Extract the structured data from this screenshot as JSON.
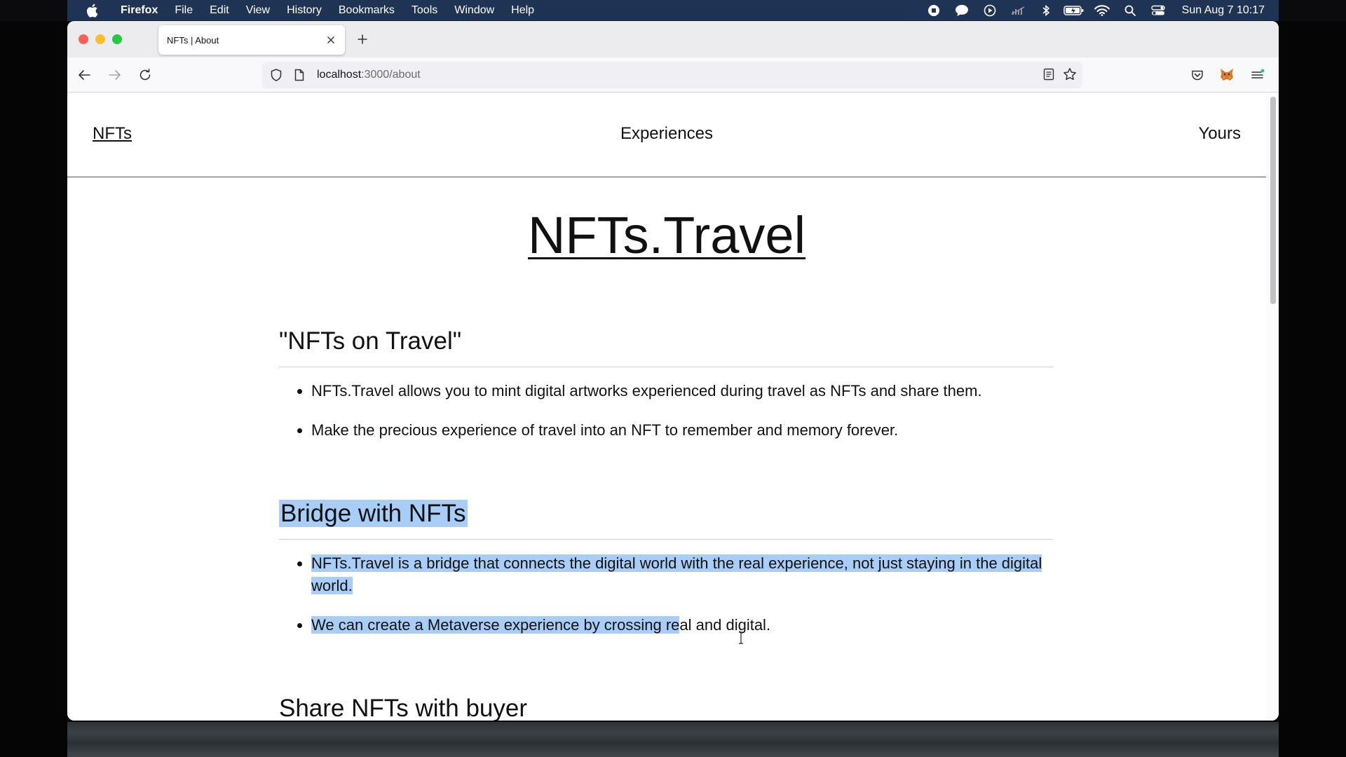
{
  "menubar": {
    "app": "Firefox",
    "items": [
      "File",
      "Edit",
      "View",
      "History",
      "Bookmarks",
      "Tools",
      "Window",
      "Help"
    ],
    "clock": "Sun Aug 7  10:17",
    "status_icons": [
      "record-icon",
      "chat-icon",
      "play-icon",
      "mute-icon",
      "bluetooth-icon",
      "battery-icon",
      "wifi-icon",
      "spotlight-icon",
      "control-center-icon"
    ]
  },
  "browser": {
    "tab_title": "NFTs | About",
    "url_host": "localhost",
    "url_path": ":3000/about"
  },
  "site": {
    "nav": {
      "left": "NFTs",
      "center": "Experiences",
      "right": "Yours"
    },
    "title": "NFTs.Travel",
    "sections": [
      {
        "heading": "\"NFTs on Travel\"",
        "items": [
          "NFTs.Travel allows you to mint digital artworks experienced during travel as NFTs and share them.",
          "Make the precious experience of travel into an NFT to remember and memory forever."
        ]
      },
      {
        "heading": "Bridge with NFTs",
        "items": [
          "NFTs.Travel is a bridge that connects the digital world with the real experience, not just staying in the digital world.",
          "We can create a Metaverse experience by crossing re"
        ],
        "item2_rest": "al and digital."
      },
      {
        "heading": "Share NFTs with buyer"
      }
    ]
  },
  "colors": {
    "menubar": "#1f3455",
    "selection": "#a8cdf6"
  }
}
